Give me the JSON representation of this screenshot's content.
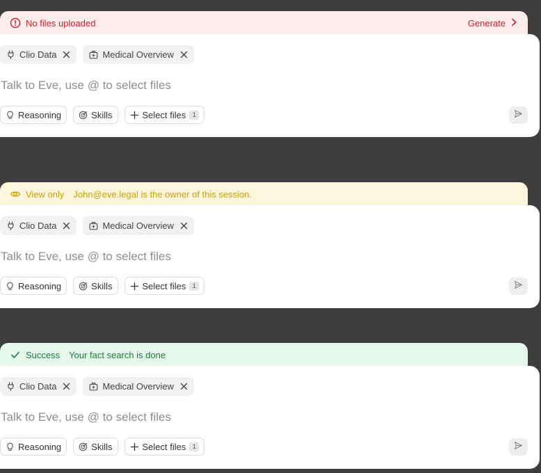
{
  "panels": [
    {
      "banner": {
        "type": "error",
        "icon": "alert-circle-icon",
        "title": "No files uploaded",
        "message": "",
        "action": "Generate"
      },
      "chips": [
        {
          "label": "Clio Data",
          "icon": "plug-icon"
        },
        {
          "label": "Medical Overview",
          "icon": "medical-bag-icon"
        }
      ],
      "placeholder": "Talk to Eve, use @ to select files",
      "tools": {
        "reasoning": "Reasoning",
        "skills": "Skills",
        "select_files": "Select files",
        "select_files_count": "1"
      }
    },
    {
      "banner": {
        "type": "warning",
        "icon": "eye-icon",
        "title": "View only",
        "message": "John@eve.legal is the owner of this session.",
        "action": ""
      },
      "chips": [
        {
          "label": "Clio Data",
          "icon": "plug-icon"
        },
        {
          "label": "Medical Overview",
          "icon": "medical-bag-icon"
        }
      ],
      "placeholder": "Talk to Eve, use @ to select files",
      "tools": {
        "reasoning": "Reasoning",
        "skills": "Skills",
        "select_files": "Select files",
        "select_files_count": "1"
      }
    },
    {
      "banner": {
        "type": "success",
        "icon": "check-icon",
        "title": "Success",
        "message": "Your fact search is done",
        "action": ""
      },
      "chips": [
        {
          "label": "Clio Data",
          "icon": "plug-icon"
        },
        {
          "label": "Medical Overview",
          "icon": "medical-bag-icon"
        }
      ],
      "placeholder": "Talk to Eve, use @ to select files",
      "tools": {
        "reasoning": "Reasoning",
        "skills": "Skills",
        "select_files": "Select files",
        "select_files_count": "1"
      }
    }
  ],
  "colors": {
    "background": "#3d3d3d",
    "error": "#d1202f",
    "warning": "#c9a100",
    "success": "#1e7a3d"
  }
}
